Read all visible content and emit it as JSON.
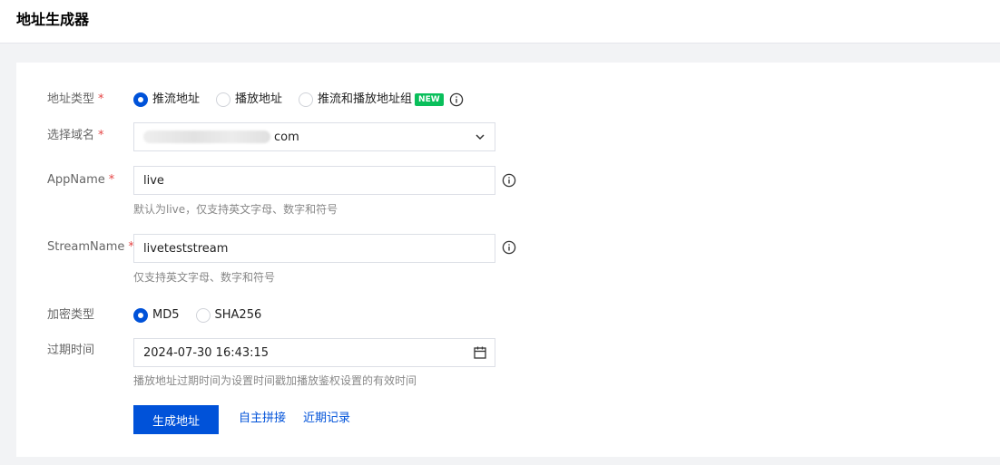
{
  "page": {
    "title": "地址生成器"
  },
  "form": {
    "address_type": {
      "label": "地址类型",
      "required_mark": "*",
      "options": [
        "推流地址",
        "播放地址",
        "推流和播放地址组"
      ],
      "selected": "推流地址",
      "new_badge": "NEW"
    },
    "domain": {
      "label": "选择域名",
      "required_mark": "*",
      "value_suffix": "com"
    },
    "app_name": {
      "label": "AppName",
      "required_mark": "*",
      "value": "live",
      "help": "默认为live，仅支持英文字母、数字和符号"
    },
    "stream_name": {
      "label": "StreamName",
      "required_mark": "*",
      "value": "liveteststream",
      "help": "仅支持英文字母、数字和符号"
    },
    "encryption_type": {
      "label": "加密类型",
      "options": [
        "MD5",
        "SHA256"
      ],
      "selected": "MD5"
    },
    "expire_time": {
      "label": "过期时间",
      "value": "2024-07-30 16:43:15",
      "help": "播放地址过期时间为设置时间戳加播放鉴权设置的有效时间"
    }
  },
  "actions": {
    "generate_label": "生成地址",
    "custom_join_label": "自主拼接",
    "recent_records_label": "近期记录"
  },
  "colors": {
    "primary": "#0052d9",
    "required": "#e54545",
    "badge": "#0abf5b"
  },
  "icons": {
    "info": "info-icon",
    "dropdown": "chevron-down-icon",
    "calendar": "calendar-icon"
  }
}
